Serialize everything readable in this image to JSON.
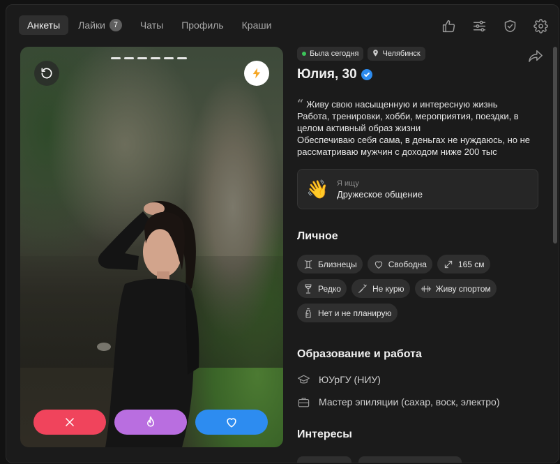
{
  "nav": {
    "tabs": [
      {
        "label": "Анкеты",
        "active": true
      },
      {
        "label": "Лайки",
        "badge": "7"
      },
      {
        "label": "Чаты"
      },
      {
        "label": "Профиль"
      },
      {
        "label": "Краши"
      }
    ],
    "icons": [
      "thumbs-up-icon",
      "sliders-icon",
      "shield-check-icon",
      "gear-icon"
    ]
  },
  "photo": {
    "pages": 6,
    "icons": {
      "rewind": "rewind-icon",
      "boost": "lightning-icon"
    },
    "actions": {
      "dislike": "close-icon",
      "super": "flame-icon",
      "like": "heart-icon"
    },
    "colors": {
      "dislike": "#f0445c",
      "super": "#b96ee0",
      "like": "#2d8cf0",
      "boost": "#f5a623"
    }
  },
  "profile": {
    "status": "Была сегодня",
    "city": "Челябинск",
    "name": "Юлия, 30",
    "verified": true,
    "bio": [
      "Живу свою насыщенную и интересную жизнь",
      "Работа, тренировки, хобби, мероприятия, поездки, в целом активный образ жизни",
      "Обеспечиваю себя сама, в деньгах не нуждаюсь, но не рассматриваю мужчин с доходом ниже 200 тыс"
    ],
    "seeking": {
      "emoji": "👋",
      "label": "Я ищу",
      "value": "Дружеское общение"
    }
  },
  "personal": {
    "title": "Личное",
    "tags": [
      {
        "icon": "gemini-icon",
        "label": "Близнецы"
      },
      {
        "icon": "heart-outline-icon",
        "label": "Свободна"
      },
      {
        "icon": "height-icon",
        "label": "165 см"
      },
      {
        "icon": "wine-glass-icon",
        "label": "Редко"
      },
      {
        "icon": "no-smoking-icon",
        "label": "Не курю"
      },
      {
        "icon": "dumbbell-icon",
        "label": "Живу спортом"
      },
      {
        "icon": "baby-bottle-icon",
        "label": "Нет и не планирую"
      }
    ]
  },
  "education": {
    "title": "Образование и работа",
    "rows": [
      {
        "icon": "graduation-cap-icon",
        "label": "ЮУрГУ (НИУ)"
      },
      {
        "icon": "briefcase-icon",
        "label": "Мастер эпиляции (сахар, воск, электро)"
      }
    ]
  },
  "interests": {
    "title": "Интересы"
  }
}
